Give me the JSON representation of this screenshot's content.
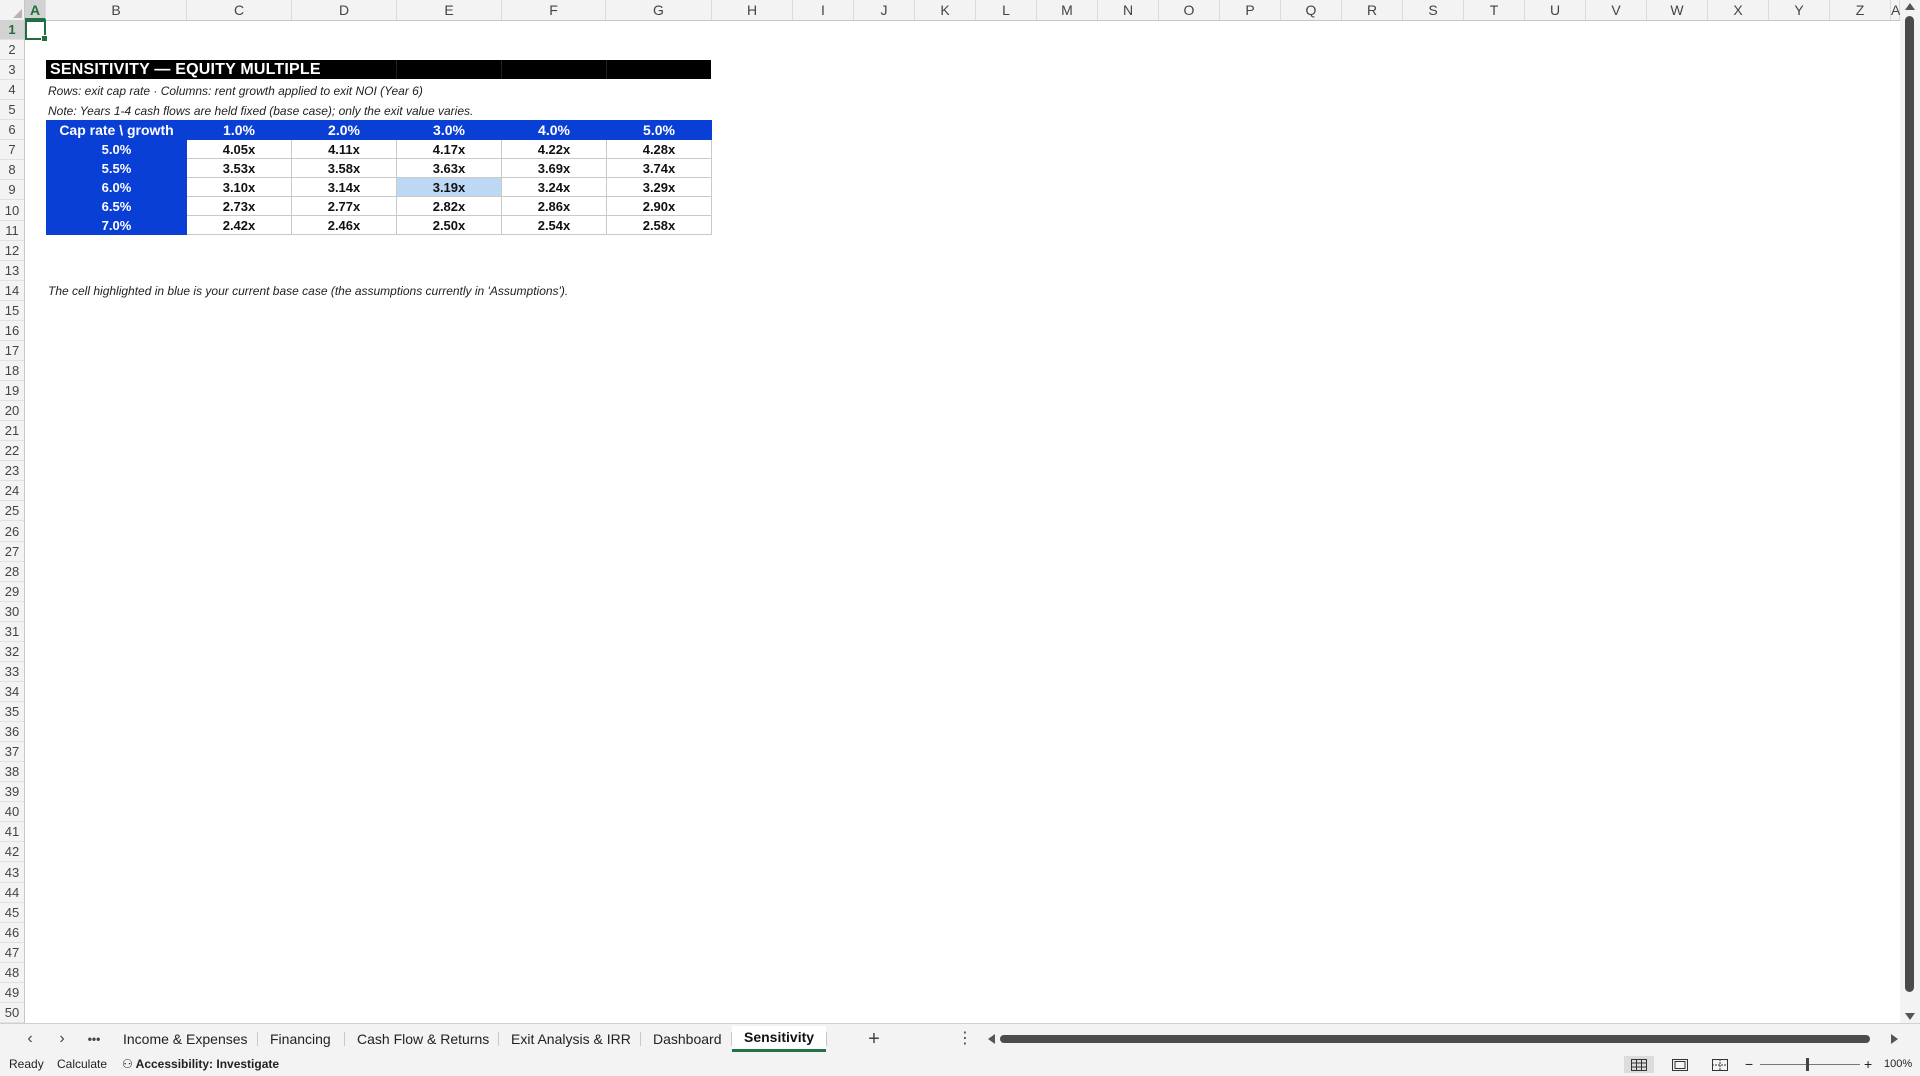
{
  "columns": [
    "A",
    "B",
    "C",
    "D",
    "E",
    "F",
    "G",
    "H",
    "I",
    "J",
    "K",
    "L",
    "M",
    "N",
    "O",
    "P",
    "Q",
    "R",
    "S",
    "T",
    "U",
    "V",
    "W",
    "X",
    "Y",
    "Z",
    "A"
  ],
  "rows": [
    "1",
    "2",
    "3",
    "4",
    "5",
    "6",
    "7",
    "8",
    "9",
    "10",
    "11",
    "12",
    "13",
    "14",
    "15",
    "16",
    "17",
    "18",
    "19",
    "20",
    "21",
    "22",
    "23",
    "24",
    "25",
    "26",
    "27",
    "28",
    "29",
    "30",
    "31",
    "32",
    "33",
    "34",
    "35",
    "36",
    "37",
    "38",
    "39",
    "40",
    "41",
    "42",
    "43",
    "44",
    "45",
    "46",
    "47",
    "48",
    "49",
    "50"
  ],
  "sheet": {
    "title": "SENSITIVITY — EQUITY MULTIPLE",
    "subtitle": "Rows: exit cap rate · Columns: rent growth applied to exit NOI (Year 6)",
    "note": "Note: Years 1-4 cash flows are held fixed (base case); only the exit value varies.",
    "footnote": "The cell highlighted in blue is your current base case (the assumptions currently in 'Assumptions').",
    "table": {
      "corner": "Cap rate \\ growth",
      "col_headers": [
        "1.0%",
        "2.0%",
        "3.0%",
        "4.0%",
        "5.0%"
      ],
      "rows": [
        {
          "label": "5.0%",
          "values": [
            "4.05x",
            "4.11x",
            "4.17x",
            "4.22x",
            "4.28x"
          ]
        },
        {
          "label": "5.5%",
          "values": [
            "3.53x",
            "3.58x",
            "3.63x",
            "3.69x",
            "3.74x"
          ]
        },
        {
          "label": "6.0%",
          "values": [
            "3.10x",
            "3.14x",
            "3.19x",
            "3.24x",
            "3.29x"
          ]
        },
        {
          "label": "6.5%",
          "values": [
            "2.73x",
            "2.77x",
            "2.82x",
            "2.86x",
            "2.90x"
          ]
        },
        {
          "label": "7.0%",
          "values": [
            "2.42x",
            "2.46x",
            "2.50x",
            "2.54x",
            "2.58x"
          ]
        }
      ],
      "base_case_row": 2,
      "base_case_col": 2
    }
  },
  "tabs": {
    "more": "•••",
    "sheets": [
      "Income & Expenses",
      "Financing",
      "Cash Flow & Returns",
      "Exit Analysis & IRR",
      "Dashboard",
      "Sensitivity"
    ],
    "active": "Sensitivity",
    "add": "+",
    "options": "⋮"
  },
  "status": {
    "ready": "Ready",
    "calculate": "Calculate",
    "accessibility": "Accessibility: Investigate",
    "zoom": "100%"
  },
  "colors": {
    "header_blue": "#0a3fd6",
    "base_case": "#bcd8f5",
    "selection_green": "#217346"
  }
}
